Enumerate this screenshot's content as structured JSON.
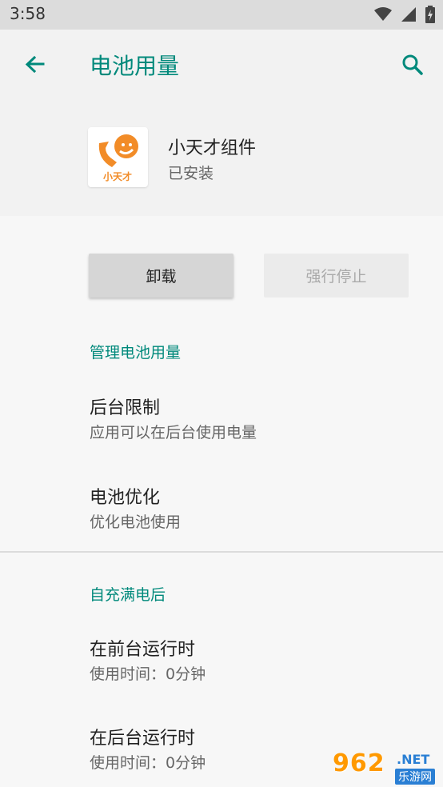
{
  "status_bar": {
    "time": "3:58",
    "icons": [
      "wifi-icon",
      "signal-icon",
      "battery-charging-icon"
    ]
  },
  "app_bar": {
    "title": "电池用量",
    "back_icon": "arrow-left-icon",
    "search_icon": "search-icon"
  },
  "app_info": {
    "name": "小天才组件",
    "status": "已安装",
    "icon_text": "小天才"
  },
  "buttons": {
    "uninstall": "卸载",
    "force_stop": "强行停止"
  },
  "manage_section": {
    "title": "管理电池用量",
    "items": [
      {
        "title": "后台限制",
        "subtitle": "应用可以在后台使用电量"
      },
      {
        "title": "电池优化",
        "subtitle": "优化电池使用"
      }
    ]
  },
  "since_full_section": {
    "title": "自充满电后",
    "items": [
      {
        "title": "在前台运行时",
        "subtitle": "使用时间：0分钟"
      },
      {
        "title": "在后台运行时",
        "subtitle": "使用时间：0分钟"
      }
    ]
  },
  "watermark": {
    "num": "962",
    "net": ".NET",
    "cn": "乐游网"
  },
  "colors": {
    "accent": "#00897b",
    "app_icon_orange": "#f28c28",
    "watermark_orange": "#ff9900",
    "watermark_blue": "#2a7fd4"
  }
}
